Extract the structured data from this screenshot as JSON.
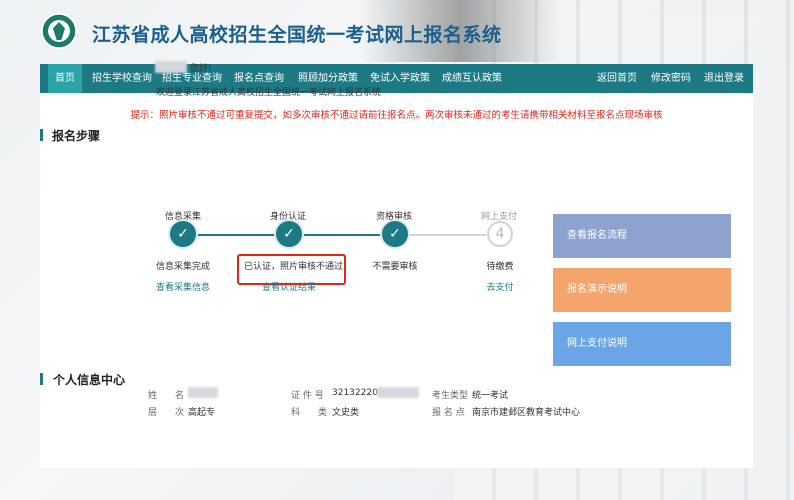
{
  "header": {
    "title": "江苏省成人高校招生全国统一考试网上报名系统"
  },
  "nav": {
    "items": [
      {
        "label": "首页",
        "active": true
      },
      {
        "label": "招生学校查询"
      },
      {
        "label": "招生专业查询"
      },
      {
        "label": "报名点查询"
      },
      {
        "label": "照顾加分政策"
      },
      {
        "label": "免试入学政策"
      },
      {
        "label": "成绩互认政策"
      }
    ],
    "right_items": [
      {
        "label": "返回首页"
      },
      {
        "label": "修改密码"
      },
      {
        "label": "退出登录"
      }
    ]
  },
  "notice": "提示：照片审核不通过可重复提交，如多次审核不通过请前往报名点。两次审核未通过的考生请携带相关材料至报名点现场审核",
  "steps_section": {
    "title": "报名步骤",
    "greeting": "您好!",
    "welcome": "欢迎登录江苏省成人高校招生全国统一考试网上报名系统",
    "steps": [
      {
        "label": "信息采集",
        "status": "信息采集完成",
        "link": "查看采集信息",
        "done": true
      },
      {
        "label": "身份认证",
        "status": "已认证，照片审核不通过",
        "link": "查看认证结果",
        "done": true
      },
      {
        "label": "资格审核",
        "status": "不需要审核",
        "link": "",
        "done": true
      },
      {
        "label": "网上支付",
        "number": "4",
        "status": "待缴费",
        "link": "去支付",
        "done": false
      }
    ]
  },
  "side_buttons": [
    {
      "label": "查看报名流程",
      "color": "#8ea2cf"
    },
    {
      "label": "报名演示说明",
      "color": "#f5a46b"
    },
    {
      "label": "网上支付说明",
      "color": "#6aa6e6"
    }
  ],
  "personal": {
    "title": "个人信息中心",
    "name_label": "姓　　名",
    "level_label": "层　　次",
    "level_value": "高起专",
    "id_label": "证 件 号",
    "id_value": "321322200",
    "subject_label": "科　　类",
    "subject_value": "文史类",
    "exam_type_label": "考生类型",
    "exam_type_value": "统一考试",
    "site_label": "报 名 点",
    "site_value": "南京市建邺区教育考试中心"
  },
  "colors": {
    "brand": "#1d7a84",
    "title": "#1b5f8f",
    "alert": "#e0251b"
  }
}
